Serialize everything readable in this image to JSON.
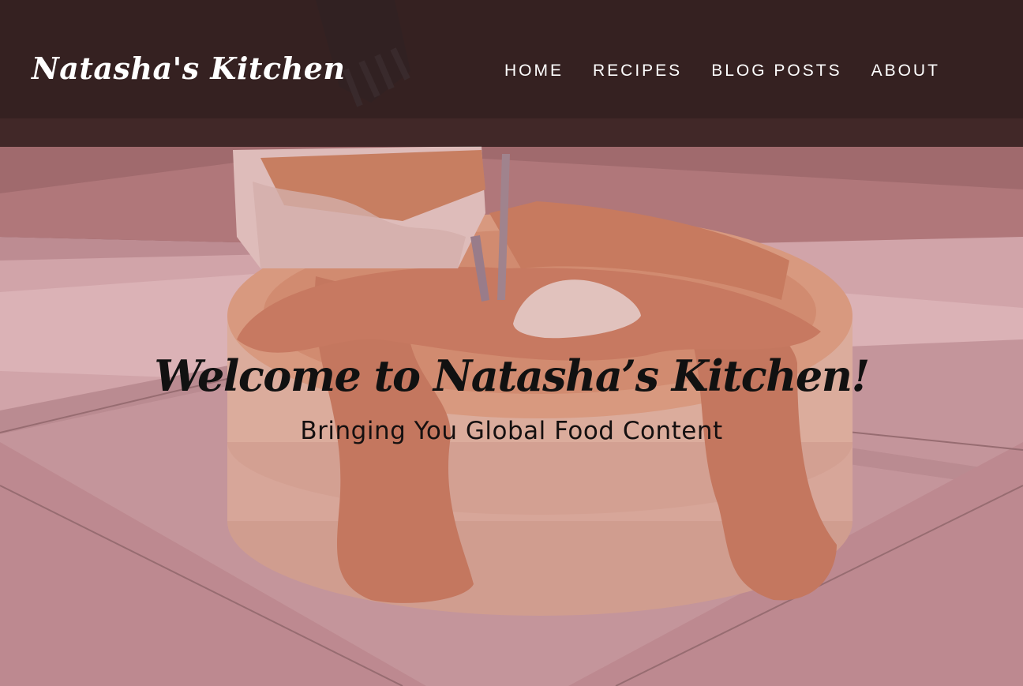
{
  "header": {
    "logo": "Natasha's Kitchen",
    "nav": [
      {
        "label": "HOME"
      },
      {
        "label": "RECIPES"
      },
      {
        "label": "BLOG POSTS"
      },
      {
        "label": "ABOUT"
      }
    ]
  },
  "hero": {
    "title": "Welcome to Natasha’s Kitchen!",
    "subtitle": "Bringing You Global Food Content",
    "image": "pancake-stack-illustration"
  },
  "colors": {
    "header_overlay": "#261818",
    "hero_tint": "#b88c8f",
    "nav_text": "#ffffff",
    "title_text": "#111111"
  }
}
